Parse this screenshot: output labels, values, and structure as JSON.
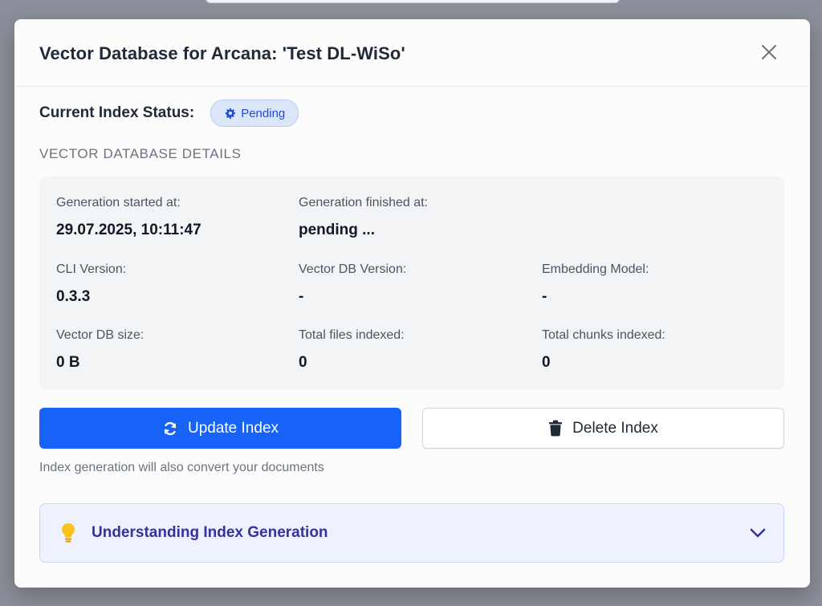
{
  "modal": {
    "title": "Vector Database for Arcana: 'Test DL-WiSo'",
    "close_icon": "close-icon"
  },
  "status": {
    "label": "Current Index Status:",
    "badge_text": "Pending",
    "badge_icon": "gear-icon"
  },
  "details": {
    "heading": "VECTOR DATABASE DETAILS",
    "items": [
      {
        "label": "Generation started at:",
        "value": "29.07.2025, 10:11:47"
      },
      {
        "label": "Generation finished at:",
        "value": "pending ..."
      },
      {
        "label": "CLI Version:",
        "value": "0.3.3"
      },
      {
        "label": "Vector DB Version:",
        "value": "-"
      },
      {
        "label": "Embedding Model:",
        "value": "-"
      },
      {
        "label": "Vector DB size:",
        "value": "0 B"
      },
      {
        "label": "Total files indexed:",
        "value": "0"
      },
      {
        "label": "Total chunks indexed:",
        "value": "0"
      }
    ]
  },
  "actions": {
    "update_label": "Update Index",
    "update_icon": "refresh-icon",
    "delete_label": "Delete Index",
    "delete_icon": "trash-icon",
    "hint": "Index generation will also convert your documents"
  },
  "accordion": {
    "title": "Understanding Index Generation",
    "icon": "lightbulb-icon",
    "chevron": "chevron-down-icon"
  },
  "colors": {
    "primary": "#1762f7",
    "badge_bg": "#dbe6fb",
    "badge_text": "#1d4fd8",
    "accordion_bg": "#eef2ff",
    "accordion_text": "#3730a3",
    "bulb": "#f8c31b"
  }
}
